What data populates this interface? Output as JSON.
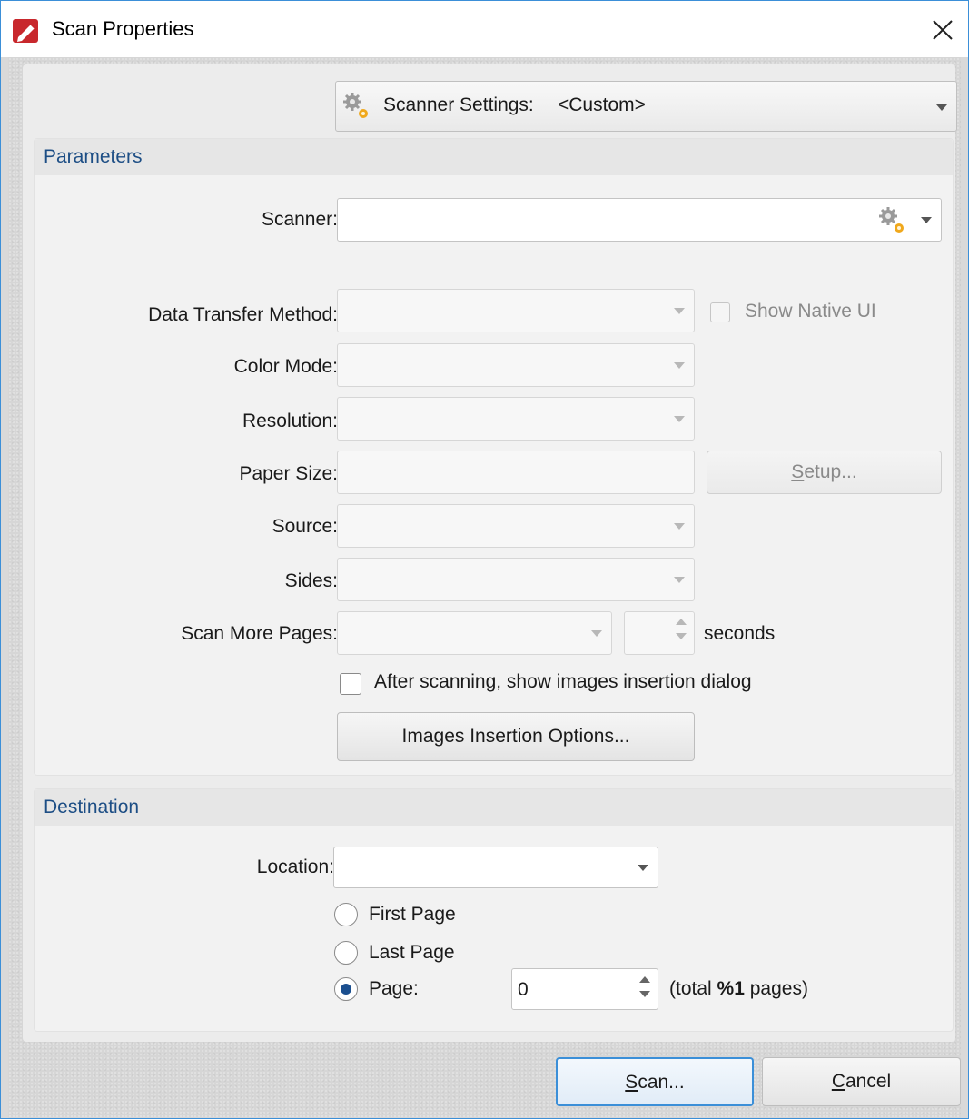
{
  "window": {
    "title": "Scan Properties",
    "close_glyph": "✕",
    "app_icon": "pdf-editor-icon"
  },
  "scanner_settings": {
    "label": "Scanner Settings:",
    "value": "<Custom>",
    "icon": "gear-icon"
  },
  "parameters": {
    "title": "Parameters",
    "scanner_label": "Scanner:",
    "scanner_value": "",
    "data_transfer_label": "Data Transfer Method:",
    "show_native_ui_label": "Show Native UI",
    "color_mode_label": "Color Mode:",
    "resolution_label": "Resolution:",
    "paper_size_label": "Paper Size:",
    "setup_button": {
      "mnemonic": "S",
      "rest": "etup..."
    },
    "source_label": "Source:",
    "sides_label": "Sides:",
    "scan_more_pages_label": "Scan More Pages:",
    "seconds_label": "seconds",
    "after_scanning_label": "After scanning, show images insertion dialog",
    "insertion_options_button": "Images Insertion Options..."
  },
  "destination": {
    "title": "Destination",
    "location_label": "Location:",
    "location_value": "",
    "first_page_label": "First Page",
    "last_page_label": "Last Page",
    "page_label": "Page:",
    "page_value": "0",
    "total_pre": "(total ",
    "total_bold": "%1",
    "total_post": " pages)",
    "selected_option": "Page"
  },
  "footer": {
    "scan_button": {
      "mnemonic": "S",
      "rest": "can..."
    },
    "cancel_button": {
      "mnemonic": "C",
      "rest": "ancel"
    }
  },
  "colors": {
    "accent_border": "#3b8fd8",
    "section_title": "#1d4e85",
    "radio_dot": "#1b4f8f"
  }
}
